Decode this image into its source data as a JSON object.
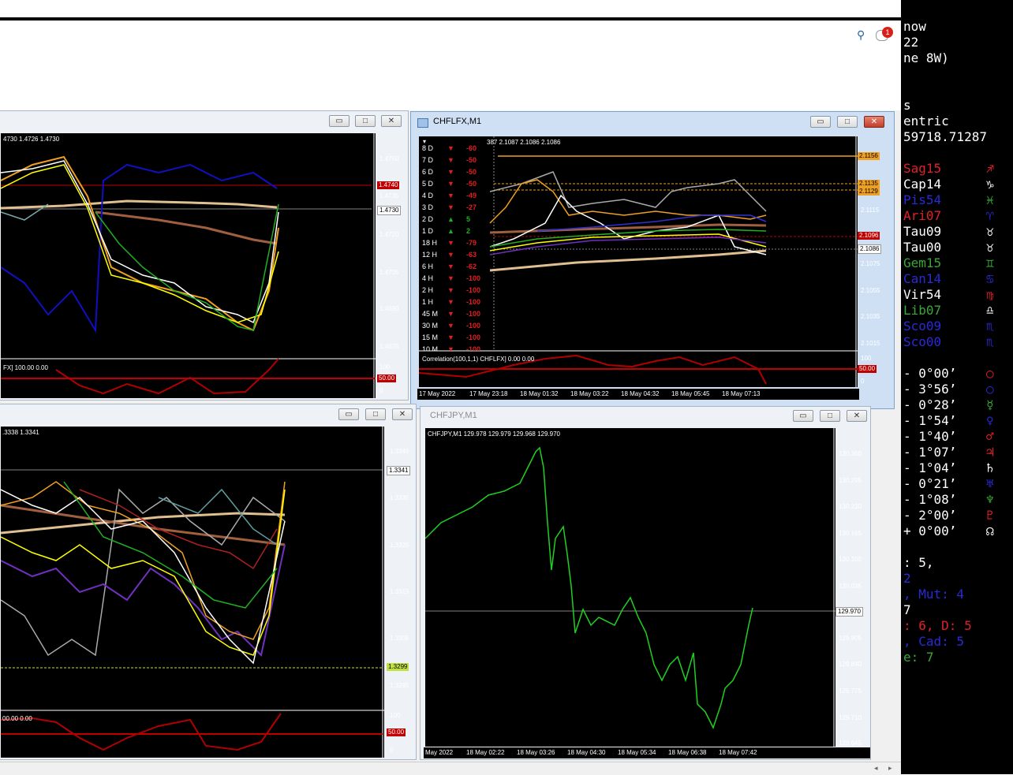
{
  "toolbar": {
    "search_icon": "magnifier-icon",
    "notification_count": "1"
  },
  "windows": {
    "w1": {
      "header_text": "4730 1.4726 1.4730",
      "price_labels": [
        "1.4750",
        "1.4745",
        "1.4735",
        "1.4730",
        "1.4720",
        "1.4705",
        "1.4690",
        "1.4675"
      ],
      "price_tags": [
        {
          "text": "1.4740",
          "color": "#c00000"
        },
        {
          "text": "1.4730",
          "color": "#000000"
        }
      ],
      "indicator_caption": "FX] 100.00 0.00",
      "indicator_labels": [
        "100",
        "50.00",
        "0"
      ]
    },
    "w2": {
      "title": "CHFLFX,M1",
      "header_text": "387 2.1087 2.1086 2.1086",
      "signals": [
        {
          "label": "8 D",
          "dir": "down",
          "value": "-60"
        },
        {
          "label": "7 D",
          "dir": "down",
          "value": "-50"
        },
        {
          "label": "6 D",
          "dir": "down",
          "value": "-50"
        },
        {
          "label": "5 D",
          "dir": "down",
          "value": "-50"
        },
        {
          "label": "4 D",
          "dir": "down",
          "value": "-49"
        },
        {
          "label": "3 D",
          "dir": "down",
          "value": "-27"
        },
        {
          "label": "2 D",
          "dir": "up",
          "value": "5"
        },
        {
          "label": "1 D",
          "dir": "up",
          "value": "2"
        },
        {
          "label": "18 H",
          "dir": "down",
          "value": "-79"
        },
        {
          "label": "12 H",
          "dir": "down",
          "value": "-63"
        },
        {
          "label": "6 H",
          "dir": "down",
          "value": "-62"
        },
        {
          "label": "4 H",
          "dir": "down",
          "value": "-100"
        },
        {
          "label": "2 H",
          "dir": "down",
          "value": "-100"
        },
        {
          "label": "1 H",
          "dir": "down",
          "value": "-100"
        },
        {
          "label": "45 M",
          "dir": "down",
          "value": "-100"
        },
        {
          "label": "30 M",
          "dir": "down",
          "value": "-100"
        },
        {
          "label": "15 M",
          "dir": "down",
          "value": "-100"
        },
        {
          "label": "10 M",
          "dir": "down",
          "value": "-100"
        }
      ],
      "price_labels": [
        "2.1115",
        "2.1075",
        "2.1055",
        "2.1035",
        "2.1015"
      ],
      "price_tags": [
        {
          "text": "2.1156",
          "color": "#f0a020"
        },
        {
          "text": "2.1135",
          "color": "#f0a020"
        },
        {
          "text": "2.1129",
          "color": "#f0a020"
        },
        {
          "text": "2.1096",
          "color": "#c00000"
        },
        {
          "text": "2.1086",
          "color": "#000000"
        }
      ],
      "indicator_caption": "Correlation(100,1,1) CHFLFX] 0.00 0.00",
      "indicator_labels": [
        "100",
        "50.00",
        "0"
      ],
      "time_labels": [
        "17 May 2022",
        "17 May 23:18",
        "18 May 01:32",
        "18 May 03:22",
        "18 May 04:32",
        "18 May 05:45",
        "18 May 07:13"
      ]
    },
    "w3": {
      "header_text": ".3338 1.3341",
      "price_labels": [
        "1.3345",
        "1.3335",
        "1.3325",
        "1.3315",
        "1.3305",
        "1.3295"
      ],
      "price_tags": [
        {
          "text": "1.3341",
          "color": "#000000"
        },
        {
          "text": "1.3299",
          "color": "#c0e040"
        }
      ],
      "indicator_caption": "00.00 0.00",
      "indicator_labels": [
        "100",
        "50.00",
        "0"
      ]
    },
    "w4": {
      "title": "CHFJPY,M1",
      "header_text": "CHFJPY,M1  129.978 129.979 129.968 129.970",
      "price_labels": [
        "130.360",
        "130.295",
        "130.230",
        "130.165",
        "130.100",
        "130.035",
        "129.905",
        "129.840",
        "129.775",
        "129.710",
        "129.645"
      ],
      "price_tags": [
        {
          "text": "129.970",
          "color": "#000000"
        }
      ],
      "time_labels": [
        "May 2022",
        "18 May 02:22",
        "18 May 03:26",
        "18 May 04:30",
        "18 May 05:34",
        "18 May 06:38",
        "18 May 07:42"
      ]
    }
  },
  "right_panel": {
    "header_lines": [
      "now",
      "22",
      "ne 8W)",
      "",
      "s",
      "entric",
      "59718.71287"
    ],
    "planets": [
      {
        "text": "Sag15",
        "color": "#e0202a",
        "glyph": "♐",
        "gcolor": "#e0202a"
      },
      {
        "text": "Cap14",
        "color": "#ffffff",
        "glyph": "♑",
        "gcolor": "#ffffff"
      },
      {
        "text": "Pis54",
        "color": "#2a2ad8",
        "glyph": "♓",
        "gcolor": "#38a838"
      },
      {
        "text": "Ari07",
        "color": "#e0202a",
        "glyph": "♈",
        "gcolor": "#2a2ad8"
      },
      {
        "text": "Tau09",
        "color": "#ffffff",
        "glyph": "♉",
        "gcolor": "#ffffff"
      },
      {
        "text": "Tau00",
        "color": "#ffffff",
        "glyph": "♉",
        "gcolor": "#ffffff"
      },
      {
        "text": "Gem15",
        "color": "#38a838",
        "glyph": "♊",
        "gcolor": "#38a838"
      },
      {
        "text": "Can14",
        "color": "#2a2ad8",
        "glyph": "♋",
        "gcolor": "#2a2ad8"
      },
      {
        "text": "Vir54",
        "color": "#ffffff",
        "glyph": "♍",
        "gcolor": "#e0202a"
      },
      {
        "text": "Lib07",
        "color": "#38a838",
        "glyph": "♎",
        "gcolor": "#ffffff"
      },
      {
        "text": "Sco09",
        "color": "#2a2ad8",
        "glyph": "♏",
        "gcolor": "#2a2ad8"
      },
      {
        "text": "Sco00",
        "color": "#2a2ad8",
        "glyph": "♏",
        "gcolor": "#2a2ad8"
      }
    ],
    "aspects": [
      {
        "text": "- 0°00’",
        "glyph": "○",
        "gcolor": "#e0202a"
      },
      {
        "text": "- 3°56’",
        "glyph": "○",
        "gcolor": "#2a2ad8"
      },
      {
        "text": "- 0°28’",
        "glyph": "☿",
        "gcolor": "#38a838"
      },
      {
        "text": "- 1°54’",
        "glyph": "♀",
        "gcolor": "#2a2ad8"
      },
      {
        "text": "- 1°40’",
        "glyph": "♂",
        "gcolor": "#e0202a"
      },
      {
        "text": "- 1°07’",
        "glyph": "♃",
        "gcolor": "#e0202a"
      },
      {
        "text": "- 1°04’",
        "glyph": "♄",
        "gcolor": "#ffffff"
      },
      {
        "text": "- 0°21’",
        "glyph": "♅",
        "gcolor": "#2a2ad8"
      },
      {
        "text": "- 1°08’",
        "glyph": "♆",
        "gcolor": "#38a838"
      },
      {
        "text": "- 2°00’",
        "glyph": "♇",
        "gcolor": "#e0202a"
      },
      {
        "text": "+ 0°00’",
        "glyph": "☊",
        "gcolor": "#ffffff"
      }
    ],
    "footer": [
      {
        "text": ": 5,",
        "color": "#ffffff"
      },
      {
        "text": "  2",
        "color": "#2a2ad8"
      },
      {
        "text": ", Mut: 4",
        "color": "#2a2ad8"
      },
      {
        "text": "7",
        "color": "#ffffff"
      },
      {
        "text": ": 6, D: 5",
        "color": "#e0202a"
      },
      {
        "text": ", Cad: 5",
        "color": "#2a2ad8"
      },
      {
        "text": "e: 7",
        "color": "#38a838"
      }
    ]
  }
}
